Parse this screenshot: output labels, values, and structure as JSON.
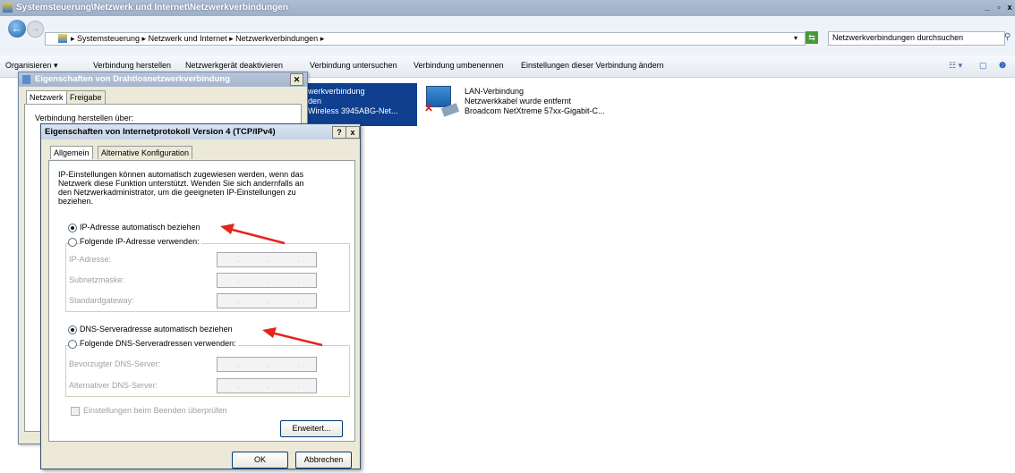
{
  "window": {
    "title": "Systemsteuerung\\Netzwerk und Internet\\Netzwerkverbindungen",
    "controls": "_|8|x"
  },
  "address": {
    "crumbs": "▸ Systemsteuerung ▸ Netzwerk und Internet ▸ Netzwerkverbindungen ▸",
    "search_placeholder": "Netzwerkverbindungen durchsuchen"
  },
  "commands": {
    "organize": "Organisieren ▾",
    "connect": "Verbindung herstellen",
    "disable": "Netzwerkgerät deaktivieren",
    "diagnose": "Verbindung untersuchen",
    "rename": "Verbindung umbenennen",
    "settings": "Einstellungen dieser Verbindung ändern"
  },
  "connections": {
    "wlan_line1": "werkverbindung",
    "wlan_line2": "den",
    "wlan_line3": "Wireless 3945ABG-Net...",
    "lan_name": "LAN-Verbindung",
    "lan_status": "Netzwerkkabel wurde entfernt",
    "lan_device": "Broadcom NetXtreme 57xx-Gigabit-C..."
  },
  "dialog_back": {
    "title": "Eigenschaften von Drahtlosnetzwerkverbindung",
    "tab1": "Netzwerk",
    "tab2": "Freigabe",
    "connect_using": "Verbindung herstellen über:"
  },
  "dialog": {
    "title": "Eigenschaften von Internetprotokoll Version 4 (TCP/IPv4)",
    "tab_general": "Allgemein",
    "tab_alt": "Alternative Konfiguration",
    "intro1": "IP-Einstellungen können automatisch zugewiesen werden, wenn das",
    "intro2": "Netzwerk diese Funktion unterstützt. Wenden Sie sich andernfalls an",
    "intro3": "den Netzwerkadministrator, um die geeigneten IP-Einstellungen zu",
    "intro4": "beziehen.",
    "ip_auto": "IP-Adresse automatisch beziehen",
    "ip_manual": "Folgende IP-Adresse verwenden:",
    "ip_label": "IP-Adresse:",
    "mask_label": "Subnetzmaske:",
    "gateway_label": "Standardgateway:",
    "dns_auto": "DNS-Serveradresse automatisch beziehen",
    "dns_manual": "Folgende DNS-Serveradressen verwenden:",
    "dns_pref": "Bevorzugter DNS-Server:",
    "dns_alt": "Alternativer DNS-Server:",
    "validate": "Einstellungen beim Beenden überprüfen",
    "advanced": "Erweitert...",
    "ok": "OK",
    "cancel": "Abbrechen",
    "help": "?",
    "close": "x"
  },
  "colors": {
    "arrow": "#e5241c",
    "selection": "#0f3f8e"
  }
}
